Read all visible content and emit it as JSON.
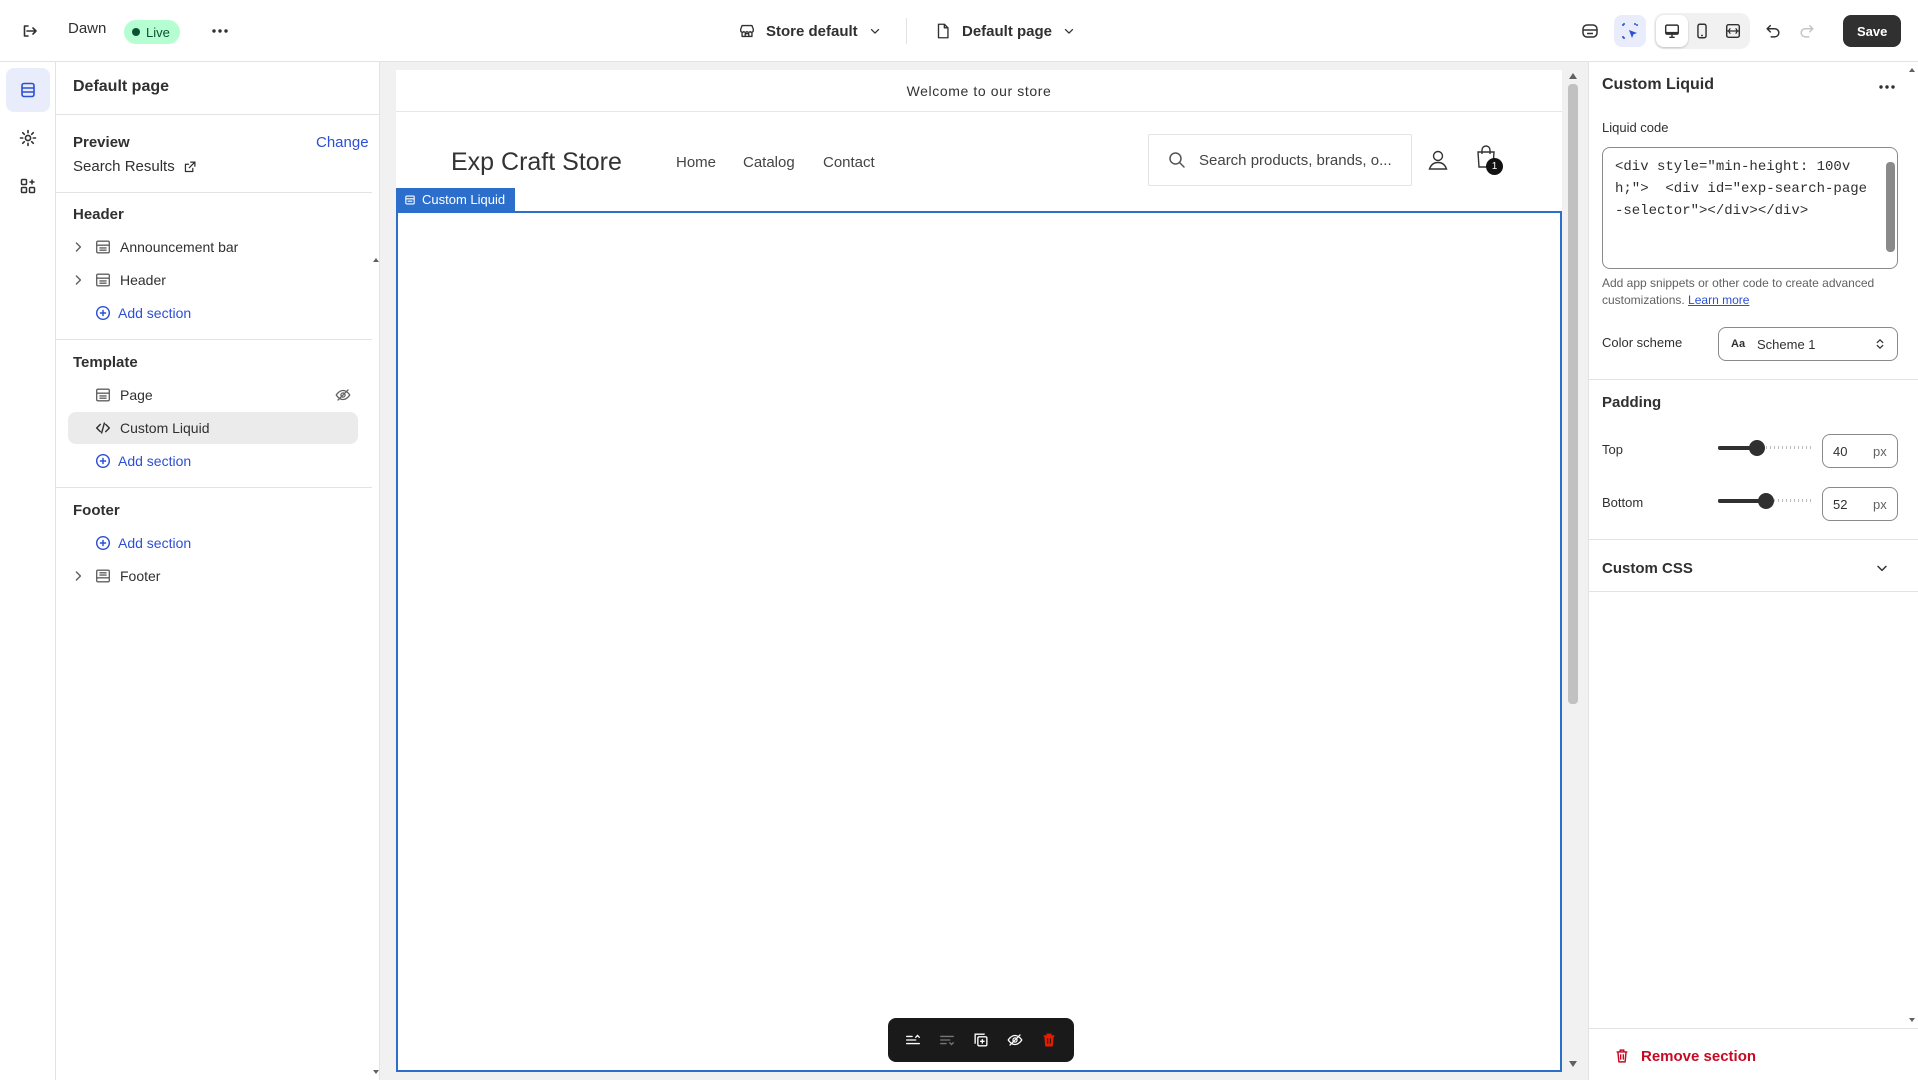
{
  "topbar": {
    "theme_name": "Dawn",
    "live_badge": "Live",
    "store_selector": "Store default",
    "page_selector": "Default page",
    "save_label": "Save"
  },
  "sidebar": {
    "title": "Default page",
    "preview_label": "Preview",
    "change_label": "Change",
    "preview_value": "Search Results",
    "header_group": {
      "title": "Header",
      "items": [
        {
          "label": "Announcement bar"
        },
        {
          "label": "Header"
        }
      ],
      "add_label": "Add section"
    },
    "template_group": {
      "title": "Template",
      "items": [
        {
          "label": "Page"
        },
        {
          "label": "Custom Liquid"
        }
      ],
      "add_label": "Add section"
    },
    "footer_group": {
      "title": "Footer",
      "add_label": "Add section",
      "items": [
        {
          "label": "Footer"
        }
      ]
    }
  },
  "preview": {
    "announcement": "Welcome to our store",
    "store_name": "Exp Craft Store",
    "nav": [
      "Home",
      "Catalog",
      "Contact"
    ],
    "search_placeholder": "Search products, brands, o...",
    "cart_count": "1",
    "section_tag": "Custom Liquid"
  },
  "right_panel": {
    "title": "Custom Liquid",
    "liquid_code_label": "Liquid code",
    "liquid_code": "<div style=\"min-height: 100vh;\">  <div id=\"exp-search-page-selector\"></div></div>",
    "help_text": "Add app snippets or other code to create advanced customizations.",
    "learn_more": "Learn more",
    "color_scheme_label": "Color scheme",
    "color_scheme_value": "Scheme 1",
    "color_scheme_glyph": "Aa",
    "padding_title": "Padding",
    "top_label": "Top",
    "top_value": "40",
    "bottom_label": "Bottom",
    "bottom_value": "52",
    "unit": "px",
    "custom_css_label": "Custom CSS",
    "remove_label": "Remove section"
  },
  "colors": {
    "accent": "#2c4fd4",
    "live_badge_bg": "#b4fed2",
    "save_bg": "#303030",
    "danger": "#c70a24",
    "selection_blue": "#2c6ecb"
  }
}
